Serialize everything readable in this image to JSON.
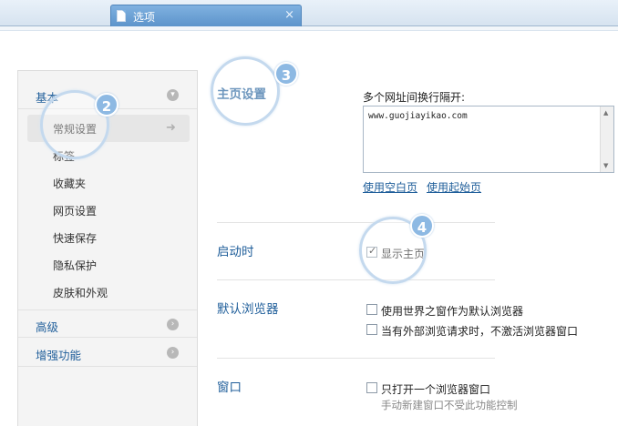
{
  "tab": {
    "title": "选项",
    "close": "×",
    "icon": "document-icon"
  },
  "sidebar": {
    "groups": [
      {
        "label": "基本",
        "icon": "chevron-down-icon"
      },
      {
        "label": "高级",
        "icon": "chevron-right-icon"
      },
      {
        "label": "增强功能",
        "icon": "chevron-right-icon"
      }
    ],
    "items": [
      {
        "label": "常规设置"
      },
      {
        "label": "标签"
      },
      {
        "label": "收藏夹"
      },
      {
        "label": "网页设置"
      },
      {
        "label": "快速保存"
      },
      {
        "label": "隐私保护"
      },
      {
        "label": "皮肤和外观"
      }
    ],
    "active_arrow": "➜"
  },
  "homepage": {
    "title": "主页设置",
    "hint": "多个网址间换行隔开:",
    "url_value": "www.guojiayikao.com",
    "use_blank": "使用空白页",
    "use_start": "使用起始页"
  },
  "startup": {
    "title": "启动时",
    "show_home": {
      "label": "显示主页",
      "checked": true
    }
  },
  "default_browser": {
    "title": "默认浏览器",
    "opt1": {
      "label": "使用世界之窗作为默认浏览器",
      "checked": false
    },
    "opt2": {
      "label": "当有外部浏览请求时，不激活浏览器窗口",
      "checked": false
    }
  },
  "window": {
    "title": "窗口",
    "opt1": {
      "label": "只打开一个浏览器窗口",
      "checked": false
    },
    "note": "手动新建窗口不受此功能控制"
  },
  "callouts": {
    "one": "2",
    "two": "3",
    "three": "4"
  }
}
